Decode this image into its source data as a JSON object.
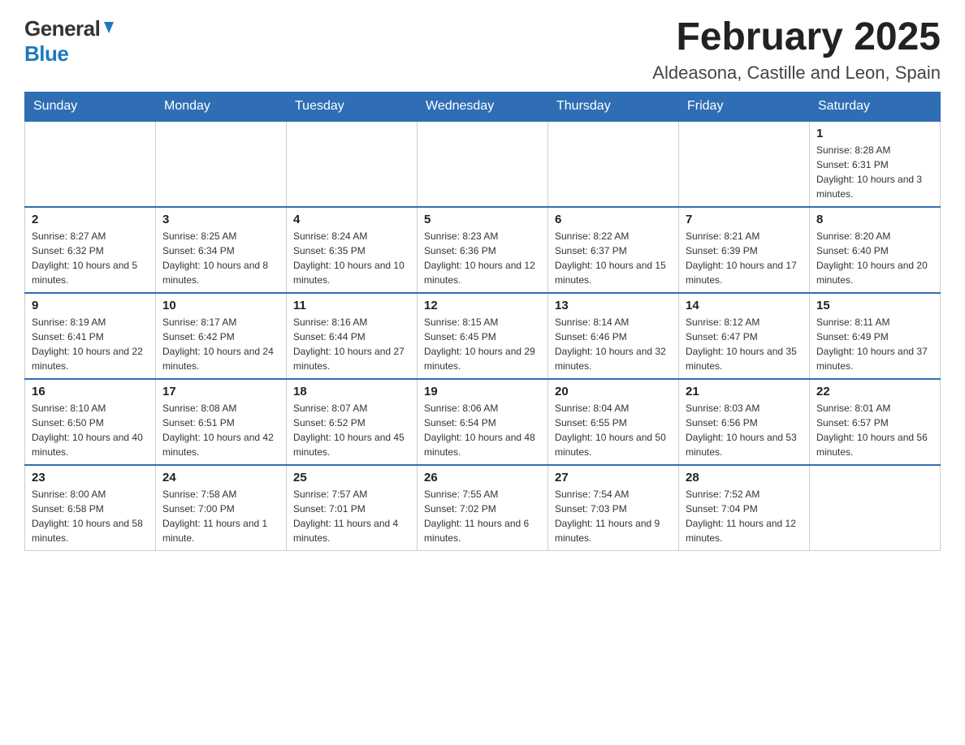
{
  "header": {
    "title": "February 2025",
    "subtitle": "Aldeasona, Castille and Leon, Spain"
  },
  "logo": {
    "general": "General",
    "blue": "Blue"
  },
  "days_of_week": [
    "Sunday",
    "Monday",
    "Tuesday",
    "Wednesday",
    "Thursday",
    "Friday",
    "Saturday"
  ],
  "weeks": [
    [
      {
        "day": "",
        "info": ""
      },
      {
        "day": "",
        "info": ""
      },
      {
        "day": "",
        "info": ""
      },
      {
        "day": "",
        "info": ""
      },
      {
        "day": "",
        "info": ""
      },
      {
        "day": "",
        "info": ""
      },
      {
        "day": "1",
        "info": "Sunrise: 8:28 AM\nSunset: 6:31 PM\nDaylight: 10 hours and 3 minutes."
      }
    ],
    [
      {
        "day": "2",
        "info": "Sunrise: 8:27 AM\nSunset: 6:32 PM\nDaylight: 10 hours and 5 minutes."
      },
      {
        "day": "3",
        "info": "Sunrise: 8:25 AM\nSunset: 6:34 PM\nDaylight: 10 hours and 8 minutes."
      },
      {
        "day": "4",
        "info": "Sunrise: 8:24 AM\nSunset: 6:35 PM\nDaylight: 10 hours and 10 minutes."
      },
      {
        "day": "5",
        "info": "Sunrise: 8:23 AM\nSunset: 6:36 PM\nDaylight: 10 hours and 12 minutes."
      },
      {
        "day": "6",
        "info": "Sunrise: 8:22 AM\nSunset: 6:37 PM\nDaylight: 10 hours and 15 minutes."
      },
      {
        "day": "7",
        "info": "Sunrise: 8:21 AM\nSunset: 6:39 PM\nDaylight: 10 hours and 17 minutes."
      },
      {
        "day": "8",
        "info": "Sunrise: 8:20 AM\nSunset: 6:40 PM\nDaylight: 10 hours and 20 minutes."
      }
    ],
    [
      {
        "day": "9",
        "info": "Sunrise: 8:19 AM\nSunset: 6:41 PM\nDaylight: 10 hours and 22 minutes."
      },
      {
        "day": "10",
        "info": "Sunrise: 8:17 AM\nSunset: 6:42 PM\nDaylight: 10 hours and 24 minutes."
      },
      {
        "day": "11",
        "info": "Sunrise: 8:16 AM\nSunset: 6:44 PM\nDaylight: 10 hours and 27 minutes."
      },
      {
        "day": "12",
        "info": "Sunrise: 8:15 AM\nSunset: 6:45 PM\nDaylight: 10 hours and 29 minutes."
      },
      {
        "day": "13",
        "info": "Sunrise: 8:14 AM\nSunset: 6:46 PM\nDaylight: 10 hours and 32 minutes."
      },
      {
        "day": "14",
        "info": "Sunrise: 8:12 AM\nSunset: 6:47 PM\nDaylight: 10 hours and 35 minutes."
      },
      {
        "day": "15",
        "info": "Sunrise: 8:11 AM\nSunset: 6:49 PM\nDaylight: 10 hours and 37 minutes."
      }
    ],
    [
      {
        "day": "16",
        "info": "Sunrise: 8:10 AM\nSunset: 6:50 PM\nDaylight: 10 hours and 40 minutes."
      },
      {
        "day": "17",
        "info": "Sunrise: 8:08 AM\nSunset: 6:51 PM\nDaylight: 10 hours and 42 minutes."
      },
      {
        "day": "18",
        "info": "Sunrise: 8:07 AM\nSunset: 6:52 PM\nDaylight: 10 hours and 45 minutes."
      },
      {
        "day": "19",
        "info": "Sunrise: 8:06 AM\nSunset: 6:54 PM\nDaylight: 10 hours and 48 minutes."
      },
      {
        "day": "20",
        "info": "Sunrise: 8:04 AM\nSunset: 6:55 PM\nDaylight: 10 hours and 50 minutes."
      },
      {
        "day": "21",
        "info": "Sunrise: 8:03 AM\nSunset: 6:56 PM\nDaylight: 10 hours and 53 minutes."
      },
      {
        "day": "22",
        "info": "Sunrise: 8:01 AM\nSunset: 6:57 PM\nDaylight: 10 hours and 56 minutes."
      }
    ],
    [
      {
        "day": "23",
        "info": "Sunrise: 8:00 AM\nSunset: 6:58 PM\nDaylight: 10 hours and 58 minutes."
      },
      {
        "day": "24",
        "info": "Sunrise: 7:58 AM\nSunset: 7:00 PM\nDaylight: 11 hours and 1 minute."
      },
      {
        "day": "25",
        "info": "Sunrise: 7:57 AM\nSunset: 7:01 PM\nDaylight: 11 hours and 4 minutes."
      },
      {
        "day": "26",
        "info": "Sunrise: 7:55 AM\nSunset: 7:02 PM\nDaylight: 11 hours and 6 minutes."
      },
      {
        "day": "27",
        "info": "Sunrise: 7:54 AM\nSunset: 7:03 PM\nDaylight: 11 hours and 9 minutes."
      },
      {
        "day": "28",
        "info": "Sunrise: 7:52 AM\nSunset: 7:04 PM\nDaylight: 11 hours and 12 minutes."
      },
      {
        "day": "",
        "info": ""
      }
    ]
  ]
}
